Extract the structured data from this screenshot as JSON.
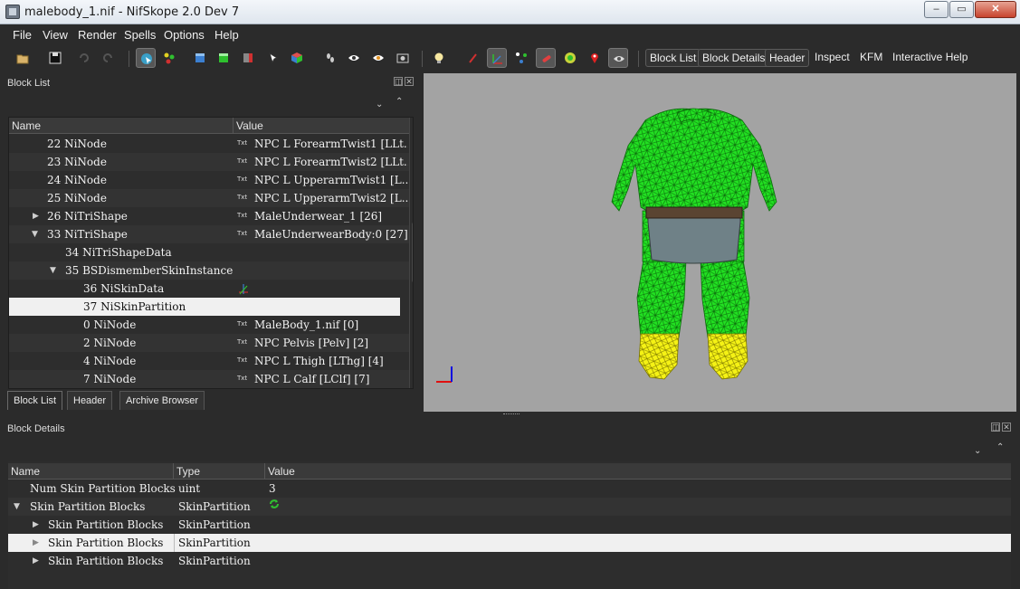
{
  "window": {
    "title": "malebody_1.nif - NifSkope 2.0 Dev 7",
    "buttons": {
      "minimize": "–",
      "maximize": "▭",
      "close": "✕"
    }
  },
  "menubar": [
    "File",
    "View",
    "Render",
    "Spells",
    "Options",
    "Help"
  ],
  "toolbar": {
    "text_buttons": [
      "Block List",
      "Block Details",
      "Header",
      "Inspect",
      "KFM",
      "Interactive Help"
    ]
  },
  "block_list": {
    "panel_title": "Block List",
    "columns": {
      "name": "Name",
      "value": "Value"
    },
    "rows": [
      {
        "name": "22 NiNode",
        "value": "NPC L ForearmTwist1 [LLt...",
        "icon": "Txt"
      },
      {
        "name": "23 NiNode",
        "value": "NPC L ForearmTwist2 [LLt...",
        "icon": "Txt"
      },
      {
        "name": "24 NiNode",
        "value": "NPC L UpperarmTwist1 [L...",
        "icon": "Txt"
      },
      {
        "name": "25 NiNode",
        "value": "NPC L UpperarmTwist2 [L...",
        "icon": "Txt"
      },
      {
        "name": "26 NiTriShape",
        "value": "MaleUnderwear_1 [26]",
        "icon": "Txt"
      },
      {
        "name": "33 NiTriShape",
        "value": "MaleUnderwearBody:0 [27]",
        "icon": "Txt"
      },
      {
        "name": "34 NiTriShapeData",
        "value": "",
        "icon": ""
      },
      {
        "name": "35 BSDismemberSkinInstance",
        "value": "",
        "icon": ""
      },
      {
        "name": "36 NiSkinData",
        "value": "",
        "icon": "axes"
      },
      {
        "name": "37 NiSkinPartition",
        "value": "",
        "icon": ""
      },
      {
        "name": "0 NiNode",
        "value": "MaleBody_1.nif [0]",
        "icon": "Txt"
      },
      {
        "name": "2 NiNode",
        "value": "NPC Pelvis [Pelv] [2]",
        "icon": "Txt"
      },
      {
        "name": "4 NiNode",
        "value": "NPC L Thigh [LThg] [4]",
        "icon": "Txt"
      },
      {
        "name": "7 NiNode",
        "value": "NPC L Calf [LClf] [7]",
        "icon": "Txt"
      }
    ],
    "tabs": [
      "Block List",
      "Header",
      "Archive Browser"
    ]
  },
  "block_details": {
    "panel_title": "Block Details",
    "columns": {
      "name": "Name",
      "type": "Type",
      "value": "Value"
    },
    "rows": [
      {
        "name": "Num Skin Partition Blocks",
        "type": "uint",
        "value": "3"
      },
      {
        "name": "Skin Partition Blocks",
        "type": "SkinPartition",
        "value": ""
      },
      {
        "name": "Skin Partition Blocks",
        "type": "SkinPartition",
        "value": ""
      },
      {
        "name": "Skin Partition Blocks",
        "type": "SkinPartition",
        "value": ""
      },
      {
        "name": "Skin Partition Blocks",
        "type": "SkinPartition",
        "value": ""
      }
    ]
  },
  "colors": {
    "mesh_green": "#1aff1a",
    "mesh_yellow": "#f2f20a",
    "viewport_bg": "#a3a3a3",
    "selection": "#f0f0f0"
  }
}
